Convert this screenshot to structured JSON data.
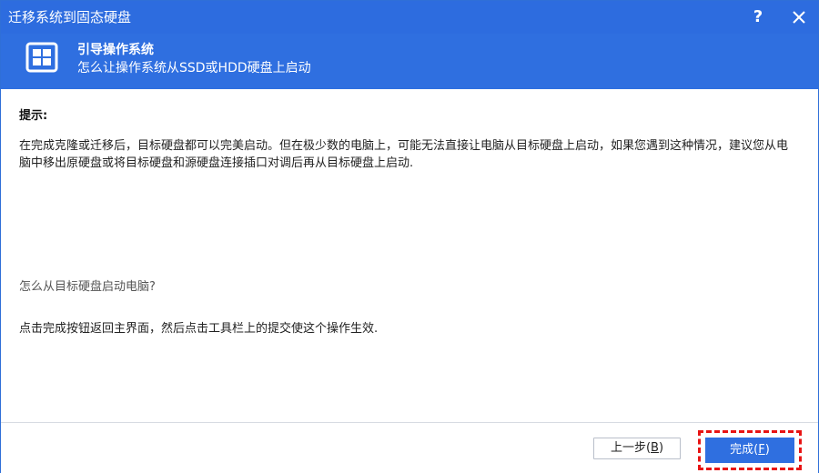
{
  "window": {
    "title": "迁移系统到固态硬盘",
    "help_label": "?",
    "close_icon": "close-icon"
  },
  "banner": {
    "icon": "windows-logo-icon",
    "title": "引导操作系统",
    "subtitle": "怎么让操作系统从SSD或HDD硬盘上启动"
  },
  "content": {
    "hint_label": "提示:",
    "paragraph": "在完成克隆或迁移后，目标硬盘都可以完美启动。但在极少数的电脑上，可能无法直接让电脑从目标硬盘上启动，如果您遇到这种情况，建议您从电脑中移出原硬盘或将目标硬盘和源硬盘连接插口对调后再从目标硬盘上启动.",
    "question_link": "怎么从目标硬盘启动电脑?",
    "instruction": "点击完成按钮返回主界面，然后点击工具栏上的提交使这个操作生效."
  },
  "footer": {
    "prev_label": "上一步(",
    "prev_key": "B",
    "finish_label": "完成(",
    "finish_key": "F",
    "close_paren": ")"
  },
  "colors": {
    "titlebar": "#2d6cdf",
    "banner": "#2f6fe0",
    "finish_button": "#2f6fe0",
    "highlight": "#e81414"
  }
}
